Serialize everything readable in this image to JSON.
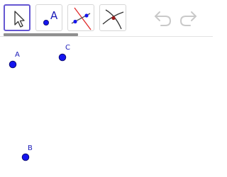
{
  "toolbar": {
    "tools": [
      {
        "icon": "move-arrow-icon",
        "selected": true
      },
      {
        "icon": "point-icon",
        "label": "A",
        "selected": false
      },
      {
        "icon": "line-through-points-icon",
        "selected": false
      },
      {
        "icon": "intersect-icon",
        "selected": false
      }
    ],
    "undo_icon": "undo-icon",
    "redo_icon": "redo-icon"
  },
  "canvas": {
    "points": [
      {
        "label": "A"
      },
      {
        "label": "C"
      },
      {
        "label": "B"
      }
    ]
  },
  "colors": {
    "accent": "#6557d2",
    "point_fill": "#1515ee",
    "point_label": "#1a1ab8",
    "line_red": "#e02a2a"
  }
}
